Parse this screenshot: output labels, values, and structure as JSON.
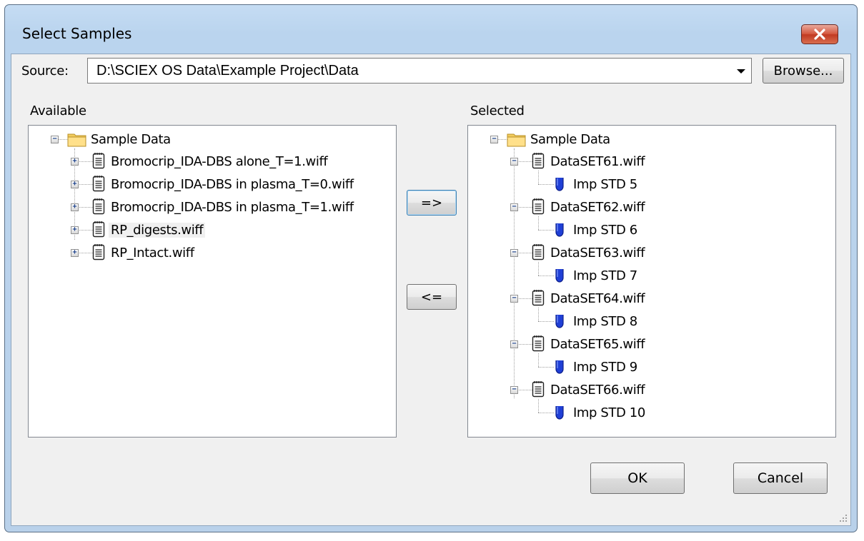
{
  "window": {
    "title": "Select Samples",
    "close_icon": "close-icon"
  },
  "source": {
    "label": "Source:",
    "value": "D:\\SCIEX OS Data\\Example Project\\Data",
    "browse_label": "Browse..."
  },
  "available": {
    "label": "Available",
    "root": "Sample Data",
    "items": [
      "Bromocrip_IDA-DBS alone_T=1.wiff",
      "Bromocrip_IDA-DBS in plasma_T=0.wiff",
      "Bromocrip_IDA-DBS in plasma_T=1.wiff",
      "RP_digests.wiff",
      "RP_Intact.wiff"
    ]
  },
  "selected": {
    "label": "Selected",
    "root": "Sample Data",
    "items": [
      {
        "file": "DataSET61.wiff",
        "sample": "Imp STD 5"
      },
      {
        "file": "DataSET62.wiff",
        "sample": "Imp STD 6"
      },
      {
        "file": "DataSET63.wiff",
        "sample": "Imp STD 7"
      },
      {
        "file": "DataSET64.wiff",
        "sample": "Imp STD 8"
      },
      {
        "file": "DataSET65.wiff",
        "sample": "Imp STD 9"
      },
      {
        "file": "DataSET66.wiff",
        "sample": "Imp STD 10"
      }
    ]
  },
  "buttons": {
    "add": "=>",
    "remove": "<=",
    "ok": "OK",
    "cancel": "Cancel"
  },
  "icons": {
    "folder": "folder-icon",
    "file": "wiff-file-icon",
    "sample": "sample-tube-icon"
  }
}
